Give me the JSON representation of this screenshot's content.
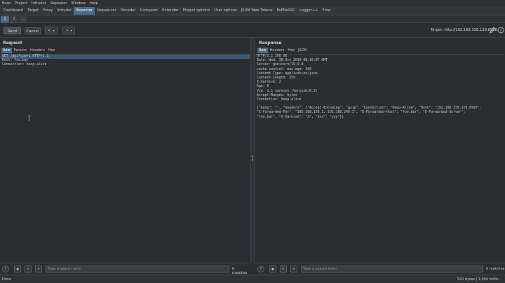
{
  "menu": [
    "Burp",
    "Project",
    "Intruder",
    "Repeater",
    "Window",
    "Help"
  ],
  "tool_tabs": [
    {
      "label": "Dashboard",
      "active": false
    },
    {
      "label": "Target",
      "active": false
    },
    {
      "label": "Proxy",
      "active": false
    },
    {
      "label": "Intruder",
      "active": false
    },
    {
      "label": "Repeater",
      "active": true
    },
    {
      "label": "Sequencer",
      "active": false
    },
    {
      "label": "Decoder",
      "active": false
    },
    {
      "label": "Comparer",
      "active": false
    },
    {
      "label": "Extender",
      "active": false
    },
    {
      "label": "Project options",
      "active": false
    },
    {
      "label": "User options",
      "active": false
    },
    {
      "label": "JSON Web Tokens",
      "active": false
    },
    {
      "label": "EsPReSSO",
      "active": false
    },
    {
      "label": "Logger++",
      "active": false
    },
    {
      "label": "Flow",
      "active": false
    }
  ],
  "repeater_tabs": [
    "1",
    "2",
    "..."
  ],
  "toolbar": {
    "send_label": "Send",
    "cancel_label": "Cancel",
    "back_glyph": "<",
    "forward_glyph": ">",
    "dropdown_glyph": "▾",
    "target_label": "Target: http://192.168.158.128:8888",
    "edit_icon": "pencil-icon",
    "help_icon": "help-icon"
  },
  "request": {
    "title": "Request",
    "tabs": [
      {
        "label": "Raw",
        "active": true
      },
      {
        "label": "Params",
        "active": false
      },
      {
        "label": "Headers",
        "active": false
      },
      {
        "label": "Hex",
        "active": false
      }
    ],
    "lines": [
      "GET /api?cow=1 HTTP/1.1",
      "Host: foo.bar",
      "Connection: keep-alive"
    ]
  },
  "response": {
    "title": "Response",
    "tabs": [
      {
        "label": "Raw",
        "active": true
      },
      {
        "label": "Headers",
        "active": false
      },
      {
        "label": "Hex",
        "active": false
      },
      {
        "label": "JSON",
        "active": false
      }
    ],
    "lines": [
      "HTTP/1.1 200 OK",
      "Date: Wed, 30 Oct 2019 08:16:07 GMT",
      "Server: gunicorn/19.9.0",
      "cache-control: max-age: 300",
      "Content-Type: application/json",
      "Content-Length: 259",
      "X-Varnish: 2",
      "Age: 0",
      "Via: 1.1 varnish (Varnish/6.3)",
      "Accept-Ranges: bytes",
      "Connection: keep-alive",
      "",
      "{\"body\": \"\", \"headers\": {\"Accept-Encoding\": \"gzip\", \"Connection\": \"Keep-Alive\", \"Host\": \"192.168.158.128:6997\",",
      "\"X-Forwarded-For\": \"192.168.158.1, 192.168.240.1\", \"X-Forwarded-Host\": \"foo.bar\", \"X-Forwarded-Server\":",
      "\"foo.bar\", \"X-Varnish\": \"3\", \"Xxx\": \"yyy\"}}"
    ]
  },
  "search_left": {
    "placeholder": "Type a search term",
    "matches": "0 matches"
  },
  "search_right": {
    "placeholder": "Type a search term",
    "matches": "0 matches"
  },
  "status": {
    "left": "Done",
    "right": "522 bytes | 1,004 millis"
  },
  "colors": {
    "accent": "#4b6b86",
    "background": "#2b2d30"
  }
}
